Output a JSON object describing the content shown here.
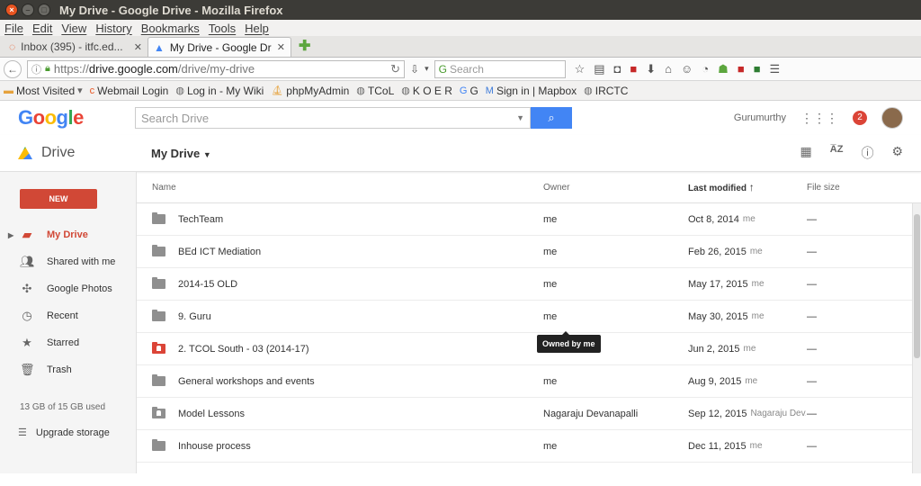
{
  "window": {
    "title": "My Drive - Google Drive - Mozilla Firefox"
  },
  "menu": [
    "File",
    "Edit",
    "View",
    "History",
    "Bookmarks",
    "Tools",
    "Help"
  ],
  "tabs": [
    {
      "label": "Inbox (395) - itfc.ed..."
    },
    {
      "label": "My Drive - Google Dr..."
    }
  ],
  "nav": {
    "url_prefix": "https://",
    "url_host": "drive.google.com",
    "url_path": "/drive/my-drive",
    "search_placeholder": "Search"
  },
  "bookmarks": [
    "Most Visited",
    "Webmail Login",
    "Log in - My Wiki",
    "phpMyAdmin",
    "TCoL",
    "K O E R",
    "G",
    "Sign in | Mapbox",
    "IRCTC"
  ],
  "header": {
    "search_placeholder": "Search Drive",
    "user_name": "Gurumurthy",
    "notifications": "2"
  },
  "drive": {
    "brand": "Drive",
    "location": "My Drive"
  },
  "sidebar": {
    "new_label": "NEW",
    "items": [
      {
        "label": "My Drive",
        "icon": "my-drive-icon"
      },
      {
        "label": "Shared with me",
        "icon": "people-icon"
      },
      {
        "label": "Google Photos",
        "icon": "photos-icon"
      },
      {
        "label": "Recent",
        "icon": "clock-icon"
      },
      {
        "label": "Starred",
        "icon": "star-icon"
      },
      {
        "label": "Trash",
        "icon": "trash-icon"
      }
    ],
    "quota": "13 GB of 15 GB used",
    "upgrade": "Upgrade storage"
  },
  "table": {
    "headers": {
      "name": "Name",
      "owner": "Owner",
      "modified": "Last modified",
      "size": "File size"
    },
    "rows": [
      {
        "name": "TechTeam",
        "owner": "me",
        "date": "Oct 8, 2014",
        "by": "me",
        "size": "—",
        "icon": "folder"
      },
      {
        "name": "BEd ICT Mediation",
        "owner": "me",
        "date": "Feb 26, 2015",
        "by": "me",
        "size": "—",
        "icon": "folder"
      },
      {
        "name": "2014-15 OLD",
        "owner": "me",
        "date": "May 17, 2015",
        "by": "me",
        "size": "—",
        "icon": "folder"
      },
      {
        "name": "9. Guru",
        "owner": "me",
        "date": "May 30, 2015",
        "by": "me",
        "size": "—",
        "icon": "folder"
      },
      {
        "name": "2. TCOL South - 03 (2014-17)",
        "owner": "me",
        "date": "Jun 2, 2015",
        "by": "me",
        "size": "—",
        "icon": "shared-folder-red"
      },
      {
        "name": "General workshops and events",
        "owner": "me",
        "date": "Aug 9, 2015",
        "by": "me",
        "size": "—",
        "icon": "folder"
      },
      {
        "name": "Model Lessons",
        "owner": "Nagaraju Devanapalli",
        "date": "Sep 12, 2015",
        "by": "Nagaraju Dev...",
        "size": "—",
        "icon": "shared-folder"
      },
      {
        "name": "Inhouse process",
        "owner": "me",
        "date": "Dec 11, 2015",
        "by": "me",
        "size": "—",
        "icon": "folder"
      }
    ]
  },
  "tooltip": "Owned by me",
  "colors": {
    "accent_red": "#d14836",
    "google_blue": "#4285f4"
  }
}
